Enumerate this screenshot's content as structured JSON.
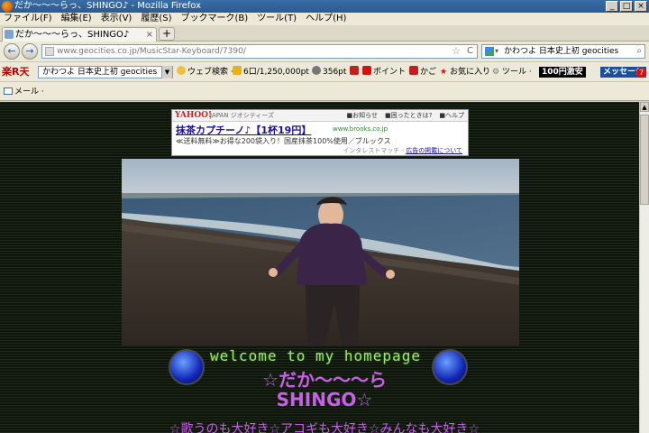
{
  "window": {
    "title": "だか〜〜〜らっ、SHINGO♪ - Mozilla Firefox",
    "minimize": "_",
    "maximize": "□",
    "close": "×"
  },
  "menu": {
    "items": [
      "ファイル(F)",
      "編集(E)",
      "表示(V)",
      "履歴(S)",
      "ブックマーク(B)",
      "ツール(T)",
      "ヘルプ(H)"
    ]
  },
  "tabs": {
    "active_title": "だか〜〜〜らっ、SHINGO♪",
    "close": "×",
    "new_tab": "+"
  },
  "nav": {
    "back": "←",
    "forward": "→",
    "url": "www.geocities.co.jp/MusicStar-Keyboard/7390/",
    "star": "☆",
    "reload": "C",
    "search_value": "かわつよ  日本史上初  geocities"
  },
  "rakuten_toolbar": {
    "logo": "楽R天",
    "select_value": "かわつよ  日本史上初  geocities",
    "web_search": "ウェブ検索",
    "points": "6口/1,250,000pt",
    "point_value": "356pt",
    "point_label": "ポイント",
    "cart": "かご",
    "favorites": "お気に入り",
    "tools": "ツール",
    "sale": "100円激安",
    "messages": "メッセージ",
    "message_count": "7"
  },
  "mail_bar": {
    "label": "メール"
  },
  "ad": {
    "logo": "YAHOO!",
    "sponsor": "JAPAN  ジオシティーズ",
    "links": [
      "■お知らせ",
      "■困ったときは?",
      "■ヘルプ"
    ],
    "title": "抹茶カプチーノ♪【1杯19円】",
    "url": "www.brooks.co.jp",
    "description": "≪送料無料≫お得な200袋入り！国産抹茶100%使用／ブルックス",
    "footer_prefix": "インタレストマッチ - ",
    "footer_link": "広告の掲載について"
  },
  "page": {
    "welcome": "welcome to my homepage",
    "site_name_line1": "☆だか〜〜〜ら",
    "site_name_line2": "SHINGO☆",
    "tagline": "☆歌うのも大好き☆アコギも大好き☆みんなも大好き☆"
  },
  "colors": {
    "page_bg": "#0f140d",
    "welcome_text": "#9fe870",
    "accent_text": "#c860e8"
  }
}
